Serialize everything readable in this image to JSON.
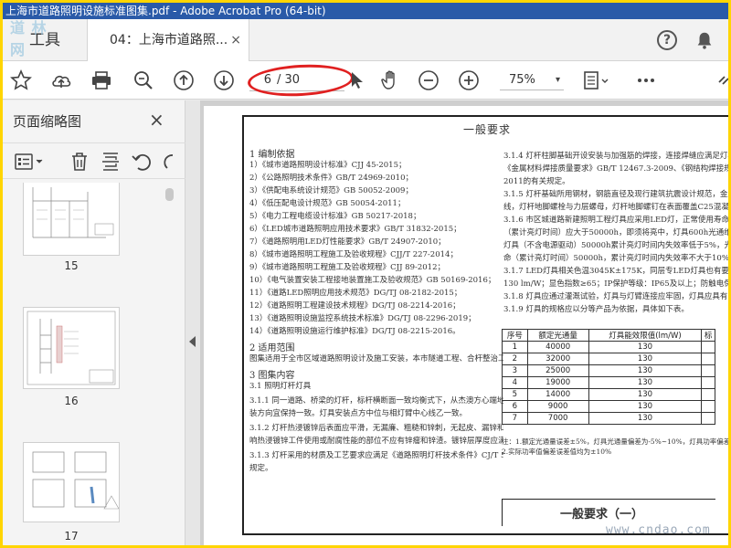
{
  "window": {
    "title": "上海市道路照明设施标准图集.pdf - Adobe Acrobat Pro (64-bit)"
  },
  "watermark_top": "道 林 网",
  "watermark_bottom": "www.cndao.com",
  "tabs": {
    "tools_label": "工具",
    "doc_label": "04：上海市道路照...",
    "close_glyph": "×"
  },
  "toolbar": {
    "current_page": "6",
    "total_pages": "/ 30",
    "zoom": "75%",
    "zoom_caret": "▾"
  },
  "sidebar": {
    "title": "页面缩略图",
    "close_glyph": "×",
    "thumbnails": [
      {
        "label": "15"
      },
      {
        "label": "16"
      },
      {
        "label": "17"
      }
    ]
  },
  "document": {
    "heading": "一般要求",
    "left_lines": [
      "1  编制依据",
      "1）《城市道路照明设计标准》CJJ 45-2015；",
      "2）《公路照明技术条件》GB/T 24969-2010；",
      "3）《供配电系统设计规范》GB 50052-2009；",
      "4）《低压配电设计规范》GB 50054-2011；",
      "5）《电力工程电缆设计标准》GB 50217-2018；",
      "6）《LED城市道路照明应用技术要求》GB/T 31832-2015；",
      "7）《道路照明用LED灯性能要求》GB/T 24907-2010；",
      "8）《城市道路照明工程施工及验收规程》CJJ/T 227-2014；",
      "9）《城市道路照明工程施工及验收规程》CJJ 89-2012；",
      "10）《电气装置安装工程接地装置施工及验收规范》GB 50169-2016；",
      "11）《道路LED照明应用技术规范》DG/TJ 08-2182-2015；",
      "12）《道路照明工程建设技术规程》DG/TJ 08-2214-2016；",
      "13）《道路照明设施监控系统技术标准》DG/TJ 08-2296-2019；",
      "14）《道路照明设施运行维护标准》DG/TJ 08-2215-2016。",
      "2  适用范围",
      "图集适用于全市区域道路照明设计及施工安装，本市隧道工程、合杆整治工程不纳入图集范围。",
      "3  图集内容",
      "3.1  照明灯杆灯具",
      "3.1.1  同一道路、桥梁的灯杆，标杆横断面一致均衡式下，从杰澳方心端地面的安装高度，符角，安",
      "装方向宜保持一致。灯具安装点方中位与相灯臂中心线乙一致。",
      "3.1.2  灯杆热浸镀锌后表面应平滑，无漏廉、粗糙和锌刺，无起皮、漏锌和残留的溶剂渣，在可能影",
      "响热浸镀锌工件使用或耐腐性能的部位不应有锌瘤和锌渣。镀锌层厚度应满足工程设计要求。",
      "3.1.3  灯杆采用的材质及工艺要求应满足《道路照明灯杆技术条件》CJ/T 527-2018的有关",
      "规定。"
    ],
    "right_lines": [
      "3.1.4  灯杆柱脚基础开设安装与加强筋的焊接，连接焊缝应满足灯杆设计确定",
      "《金属材料焊接质量要求》GB/T 12467.3-2009、《钢结构焊接规范》",
      "2011的有关规定。",
      "3.1.5  灯杆基础所用钢材，钢筋直径及现行建筑抗震设计规范，金属构件之间",
      "线，灯杆地脚螺栓与力层螺母，灯杆地脚螺钉在表面覆盖C25混凝土。",
      "3.1.6  市区城道路新建照明工程灯具应采用LED灯，正常使用寿命下，L",
      "（累计亮灯时间）应大于50000h，即须将亮中，灯具600h光通维持率不低",
      "灯具（不含电源驱动）50000h累计亮灯时间内失效率低于5%，光源失效",
      "命（累计亮灯时间）50000h，累计亮灯时间内失效率不大于10%。",
      "3.1.7  LED灯具相关色温3045K±175K，同层专LED灯具也有要求≤7500",
      "130 lm/W；显色指数≥65；IP保护等级：IP65及以上；防触电保护型式",
      "3.1.8  灯具应通过灌溉试验，灯具与灯臂连接应牢固，灯具应具有防雾漏措施",
      "3.1.9  灯具的规格应以分等产品为依据，具体如下表。"
    ],
    "table_headers": [
      "序号",
      "额定光通量",
      "灯具能效限值(lm/W)",
      "标"
    ],
    "table_rows": [
      [
        "1",
        "40000",
        "130",
        ""
      ],
      [
        "2",
        "32000",
        "130",
        ""
      ],
      [
        "3",
        "25000",
        "130",
        ""
      ],
      [
        "4",
        "19000",
        "130",
        ""
      ],
      [
        "5",
        "14000",
        "130",
        ""
      ],
      [
        "6",
        "9000",
        "130",
        ""
      ],
      [
        "7",
        "7000",
        "130",
        ""
      ]
    ],
    "table_note1": "注：1.额定光通量误差±5%，灯具光通量偏差为-5%~10%，灯具功率偏差0~10%。",
    "table_note2": "    2.实际功率值偏差误差值均为±10%",
    "footer_title": "一般要求（一）"
  }
}
